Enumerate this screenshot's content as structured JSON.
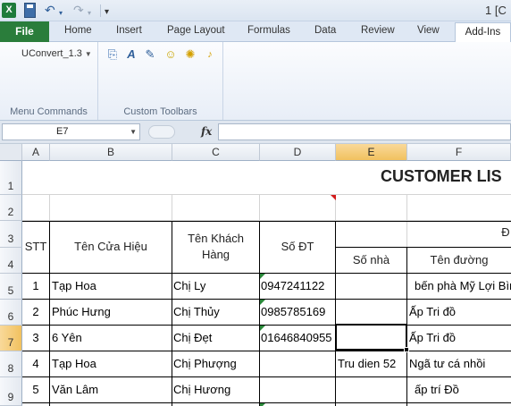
{
  "window": {
    "title_fragment": "1 [C"
  },
  "ribbon_tabs": [
    "File",
    "Home",
    "Insert",
    "Page Layout",
    "Formulas",
    "Data",
    "Review",
    "View",
    "Add-Ins"
  ],
  "ribbon": {
    "uconvert_label": "UConvert_1.3",
    "group_menu_commands": "Menu Commands",
    "group_custom_toolbars": "Custom Toolbars"
  },
  "formula_bar": {
    "name_box": "E7",
    "fx": "fx",
    "formula": ""
  },
  "columns": [
    "A",
    "B",
    "C",
    "D",
    "E",
    "F"
  ],
  "rows": [
    "1",
    "2",
    "3",
    "4",
    "5",
    "6",
    "7",
    "8",
    "9"
  ],
  "sheet": {
    "title": "CUSTOMER LIS",
    "merged_header_fragment": "Đ",
    "headers": {
      "stt": "STT",
      "shop": "Tên Cửa Hiệu",
      "customer_line1": "Tên Khách",
      "customer_line2": "Hàng",
      "phone": "Số ĐT",
      "house_no": "Số nhà",
      "street": "Tên đường"
    },
    "records": [
      {
        "stt": "1",
        "shop": "Tạp Hoa",
        "customer": "Chị Ly",
        "phone": "0947241122",
        "house": "",
        "street": "bến phà Mỹ Lợi Bìn"
      },
      {
        "stt": "2",
        "shop": "Phúc Hưng",
        "customer": "Chị Thủy",
        "phone": "0985785169",
        "house": "",
        "street": "Ấp Tri đồ"
      },
      {
        "stt": "3",
        "shop": "6 Yên",
        "customer": "Chị Đẹt",
        "phone": "01646840955",
        "house": "",
        "street": "Ấp Tri đồ"
      },
      {
        "stt": "4",
        "shop": "Tạp Hoa",
        "customer": "Chị  Phượng",
        "phone": "",
        "house": "Tru dien 52",
        "street": "Ngã tư cá nhồi"
      },
      {
        "stt": "5",
        "shop": "Văn  Lâm",
        "customer": "Chị Hương",
        "phone": "",
        "house": "",
        "street": "ấp trí Đồ"
      }
    ]
  }
}
